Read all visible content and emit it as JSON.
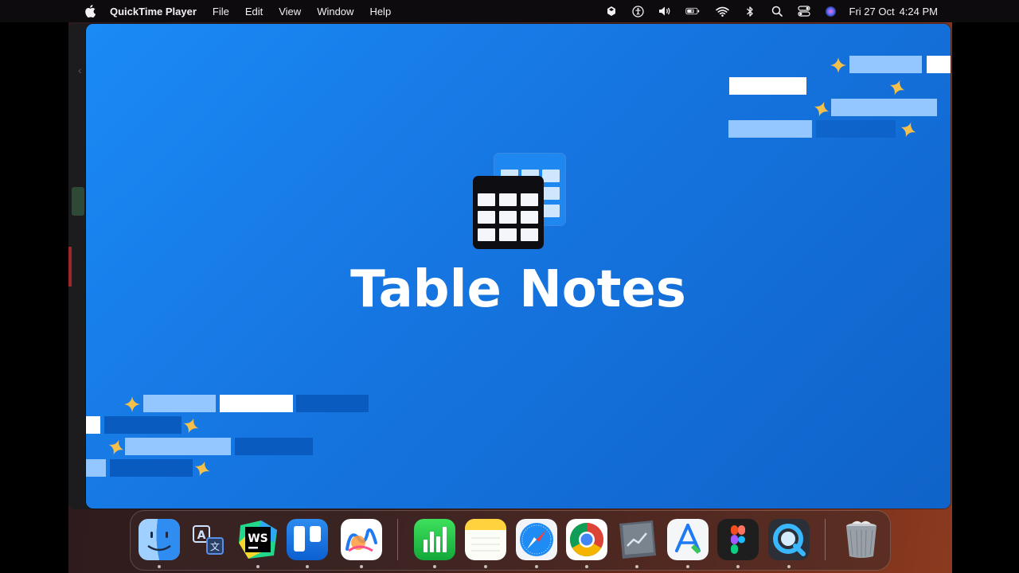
{
  "menubar": {
    "app_name": "QuickTime Player",
    "menus": [
      "File",
      "Edit",
      "View",
      "Window",
      "Help"
    ],
    "status_icons": [
      "dropbox-icon",
      "accessibility-icon",
      "volume-icon",
      "battery-icon",
      "wifi-icon",
      "bluetooth-icon",
      "spotlight-search-icon",
      "control-center-icon",
      "siri-icon"
    ],
    "date": "Fri 27 Oct",
    "time": "4:24 PM"
  },
  "video": {
    "title": "Table Notes"
  },
  "dock": {
    "apps": [
      "finder-icon",
      "translate-icon",
      "webstorm-icon",
      "trello-icon",
      "freeform-icon",
      "numbers-icon",
      "notes-icon",
      "safari-icon",
      "chrome-icon",
      "stocks-app-icon",
      "xcode-instruments-icon",
      "figma-icon",
      "quicktime-icon",
      "trash-icon"
    ]
  },
  "colors": {
    "video_background": "#1678e6",
    "accent_star": "#f5c04a",
    "bar_light": "#94c6ff",
    "bar_dark": "#0a5bc0"
  }
}
